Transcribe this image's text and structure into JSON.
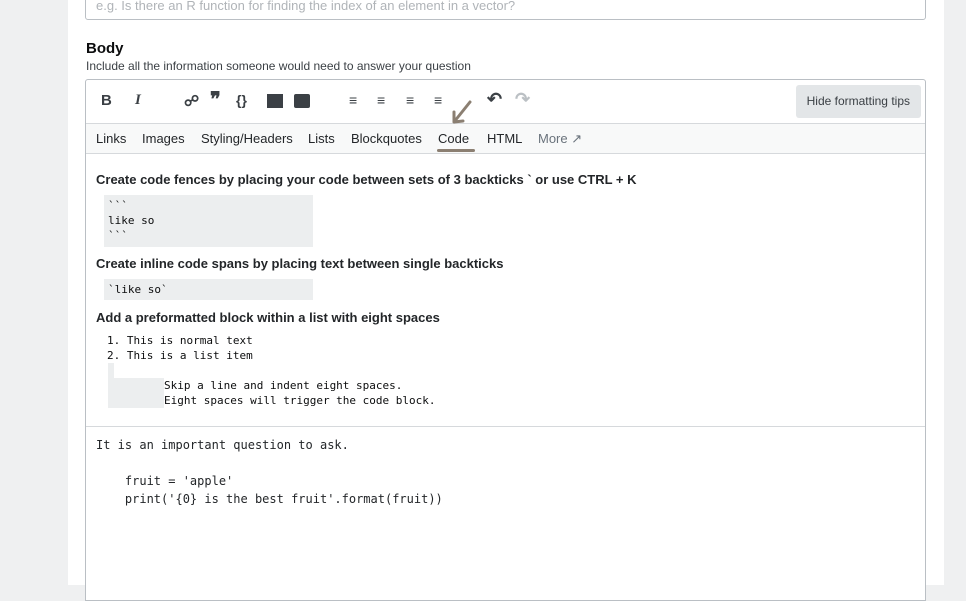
{
  "title_placeholder": "e.g. Is there an R function for finding the index of an element in a vector?",
  "body": {
    "label": "Body",
    "description": "Include all the information someone would need to answer your question"
  },
  "toolbar": {
    "hide_tips": "Hide formatting tips",
    "bold": "B",
    "italic": "I"
  },
  "tabs": [
    "Links",
    "Images",
    "Styling/Headers",
    "Lists",
    "Blockquotes",
    "Code",
    "HTML",
    "More"
  ],
  "active_tab": "Code",
  "help": {
    "h1": "Create code fences by placing your code between sets of 3 backticks ` or use CTRL + K",
    "c1": "```\nlike so\n```",
    "h2": "Create inline code spans by placing text between single backticks",
    "c2": "`like so`",
    "h3": "Add a preformatted block within a list with eight spaces",
    "l1": "1. This is normal text",
    "l2": "2. This is a list item",
    "c3": "Skip a line and indent eight spaces.\nEight spaces will trigger the code block."
  },
  "editor_text": "It is an important question to ask.\n\n    fruit = 'apple'\n    print('{0} is the best fruit'.format(fruit))"
}
